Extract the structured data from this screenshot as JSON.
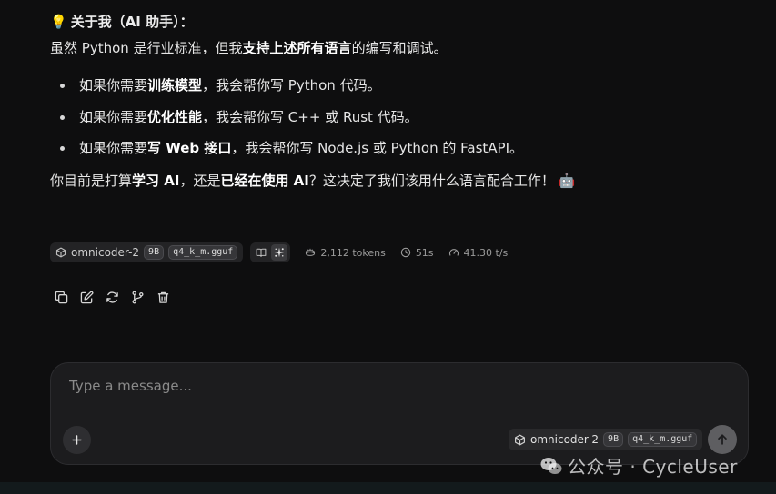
{
  "message": {
    "heading_emoji": "💡",
    "heading": "关于我（AI 助手）：",
    "intro": {
      "part1": "虽然 Python 是行业标准，但我",
      "bold": "支持上述所有语言",
      "part2": "的编写和调试。"
    },
    "points": [
      {
        "pre": "如果你需要",
        "bold": "训练模型",
        "post": "，我会帮你写 Python 代码。"
      },
      {
        "pre": "如果你需要",
        "bold": "优化性能",
        "post": "，我会帮你写 C++ 或 Rust 代码。"
      },
      {
        "pre": "如果你需要",
        "bold": "写 Web 接口",
        "post": "，我会帮你写 Node.js 或 Python 的 FastAPI。"
      }
    ],
    "closing": {
      "part1": "你目前是打算",
      "bold1": "学习 AI",
      "part2": "，还是",
      "bold2": "已经在使用 AI",
      "part3": "？这决定了我们该用什么语言配合工作！",
      "emoji": "🤖"
    }
  },
  "meta": {
    "model_name": "omnicoder-2",
    "model_size": "9B",
    "model_quant": "q4_k_m.gguf",
    "tokens": "2,112 tokens",
    "time": "51s",
    "speed": "41.30 t/s"
  },
  "actions": [
    "copy-icon",
    "edit-icon",
    "regenerate-icon",
    "branch-icon",
    "trash-icon"
  ],
  "composer": {
    "placeholder": "Type a message...",
    "model_name": "omnicoder-2",
    "model_size": "9B",
    "model_quant": "q4_k_m.gguf"
  },
  "watermark": {
    "text": "公众号 · CycleUser"
  },
  "colors": {
    "background": "#0e0e0f",
    "composer_bg": "#1c1c1e",
    "send_button": "#5e5e61"
  }
}
